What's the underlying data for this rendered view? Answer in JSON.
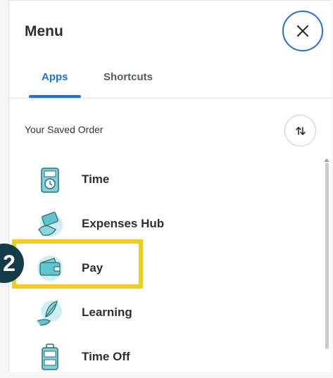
{
  "menu": {
    "title": "Menu",
    "close_icon": "close-icon"
  },
  "tabs": [
    {
      "label": "Apps",
      "active": true
    },
    {
      "label": "Shortcuts",
      "active": false
    }
  ],
  "saved_order": {
    "label": "Your Saved Order",
    "sort_icon": "sort-arrows-icon"
  },
  "apps": [
    {
      "label": "Time",
      "icon": "time-clock-icon"
    },
    {
      "label": "Expenses Hub",
      "icon": "expenses-hub-icon"
    },
    {
      "label": "Pay",
      "icon": "wallet-icon"
    },
    {
      "label": "Learning",
      "icon": "learning-feather-icon"
    },
    {
      "label": "Time Off",
      "icon": "suitcase-icon"
    }
  ],
  "annotation": {
    "step_number": "2",
    "highlight_color": "#f2cc1a",
    "badge_color": "#123c49"
  },
  "colors": {
    "accent": "#1f6fe0",
    "icon_teal": "#5fc6cf"
  }
}
